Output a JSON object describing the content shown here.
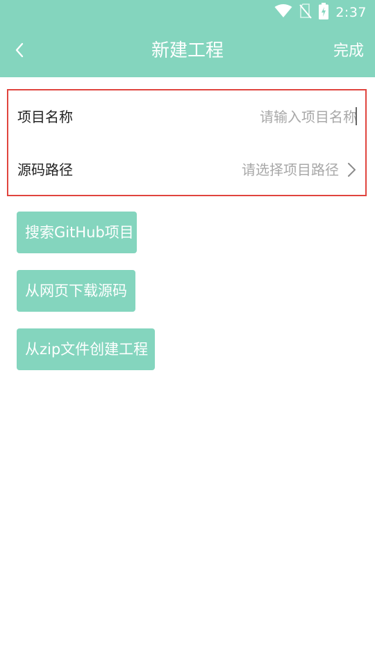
{
  "status_bar": {
    "time": "2:37",
    "icons": [
      "wifi-icon",
      "no-sim-icon",
      "battery-charging-icon"
    ]
  },
  "app_bar": {
    "back_icon": "chevron-left-icon",
    "title": "新建工程",
    "done_label": "完成"
  },
  "form": {
    "project_name": {
      "label": "项目名称",
      "value": "",
      "placeholder": "请输入项目名称"
    },
    "source_path": {
      "label": "源码路径",
      "placeholder": "请选择项目路径",
      "chevron_icon": "chevron-right-icon"
    }
  },
  "actions": {
    "search_github": "搜索GitHub项目",
    "download_web": "从网页下载源码",
    "create_from_zip": "从zip文件创建工程"
  },
  "colors": {
    "accent": "#84d5be",
    "highlight_border": "#e0443e",
    "placeholder": "#a8a8a8",
    "text": "#222222"
  }
}
